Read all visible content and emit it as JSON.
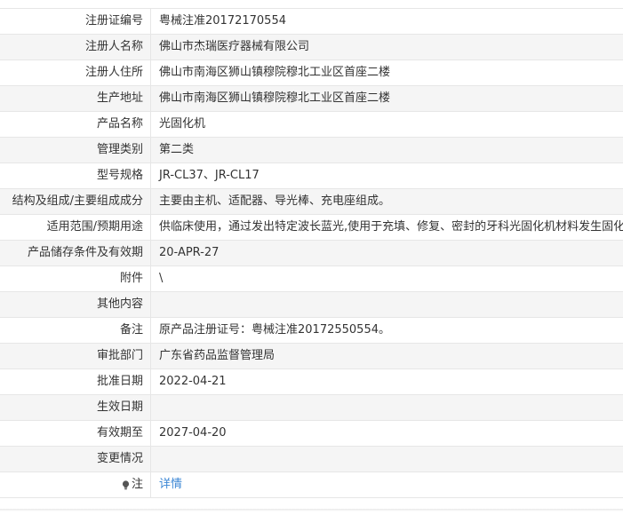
{
  "rows": [
    {
      "label": "注册证编号",
      "value": "粤械注准20172170554"
    },
    {
      "label": "注册人名称",
      "value": "佛山市杰瑞医疗器械有限公司"
    },
    {
      "label": "注册人住所",
      "value": "佛山市南海区狮山镇穆院穆北工业区首座二楼"
    },
    {
      "label": "生产地址",
      "value": "佛山市南海区狮山镇穆院穆北工业区首座二楼"
    },
    {
      "label": "产品名称",
      "value": "光固化机"
    },
    {
      "label": "管理类别",
      "value": "第二类"
    },
    {
      "label": "型号规格",
      "value": "JR-CL37、JR-CL17"
    },
    {
      "label": "结构及组成/主要组成成分",
      "value": "主要由主机、适配器、导光棒、充电座组成。"
    },
    {
      "label": "适用范围/预期用途",
      "value": "供临床使用，通过发出特定波长蓝光,使用于充填、修复、密封的牙科光固化机材料发生固化。"
    },
    {
      "label": "产品储存条件及有效期",
      "value": "20-APR-27"
    },
    {
      "label": "附件",
      "value": "\\"
    },
    {
      "label": "其他内容",
      "value": ""
    },
    {
      "label": "备注",
      "value": "原产品注册证号：粤械注准20172550554。"
    },
    {
      "label": "审批部门",
      "value": "广东省药品监督管理局"
    },
    {
      "label": "批准日期",
      "value": "2022-04-21"
    },
    {
      "label": "生效日期",
      "value": ""
    },
    {
      "label": "有效期至",
      "value": "2027-04-20"
    },
    {
      "label": "变更情况",
      "value": ""
    }
  ],
  "note": {
    "label": "注",
    "icon": "lightbulb-icon",
    "link_text": "详情",
    "link_color": "#3a86d4"
  }
}
